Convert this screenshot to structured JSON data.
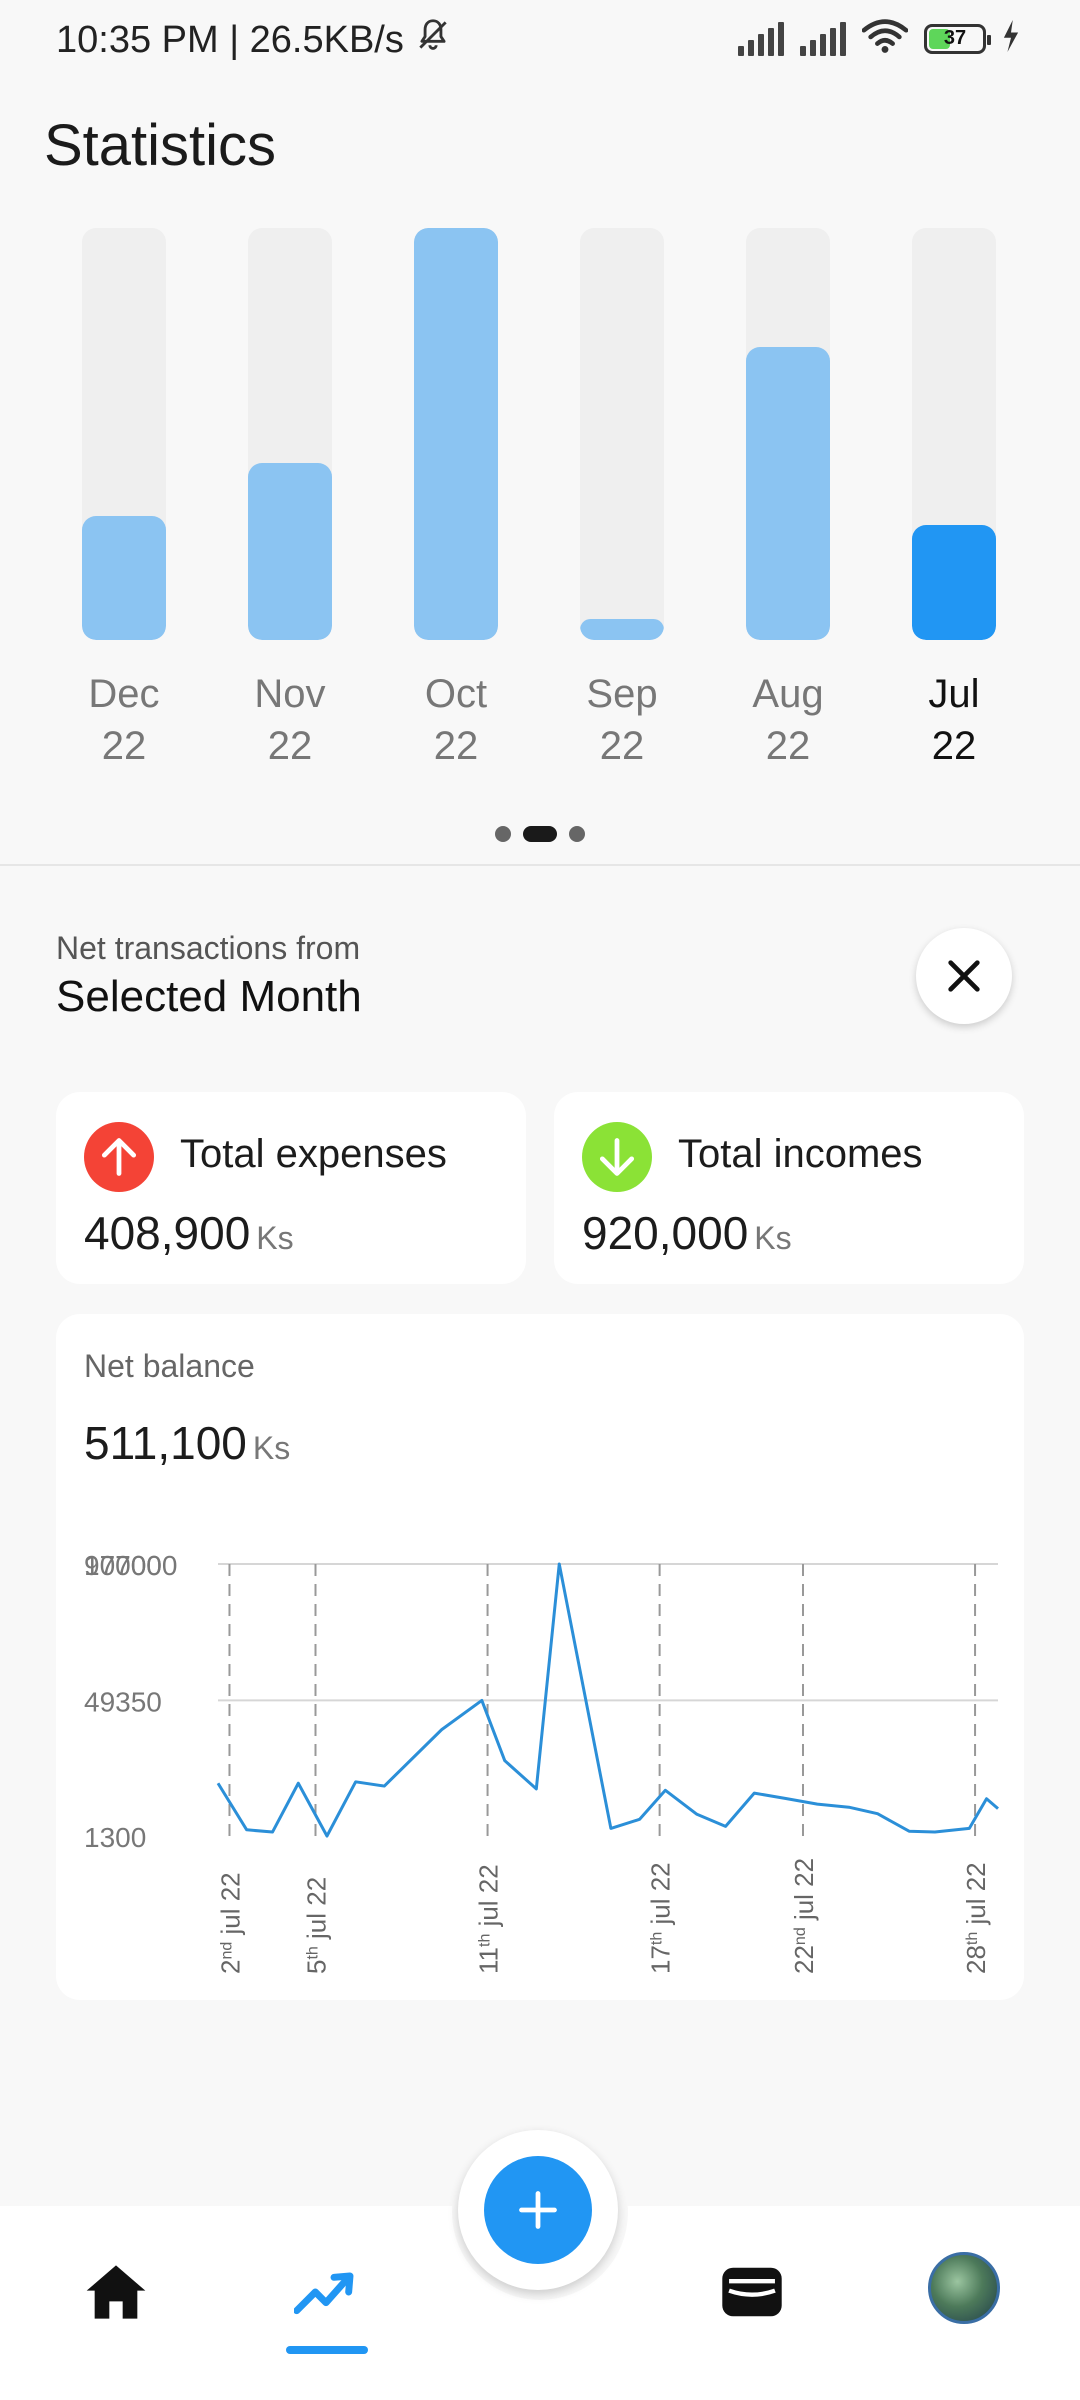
{
  "status_bar": {
    "time_speed": "10:35 PM | 26.5KB/s",
    "battery": "37"
  },
  "title": "Statistics",
  "bar_chart": [
    {
      "month": "Dec",
      "year": "22",
      "level": 0.3,
      "active": false
    },
    {
      "month": "Nov",
      "year": "22",
      "level": 0.43,
      "active": false
    },
    {
      "month": "Oct",
      "year": "22",
      "level": 1.0,
      "active": false
    },
    {
      "month": "Sep",
      "year": "22",
      "level": 0.05,
      "active": false
    },
    {
      "month": "Aug",
      "year": "22",
      "level": 0.71,
      "active": false
    },
    {
      "month": "Jul",
      "year": "22",
      "level": 0.28,
      "active": true
    }
  ],
  "pager": {
    "count": 3,
    "active": 1
  },
  "net": {
    "subtitle": "Net transactions from",
    "title": "Selected Month"
  },
  "expenses": {
    "label": "Total expenses",
    "amount": "408,900",
    "unit": "Ks",
    "color": "#f44336"
  },
  "incomes": {
    "label": "Total incomes",
    "amount": "920,000",
    "unit": "Ks",
    "color": "#8be236"
  },
  "balance": {
    "label": "Net balance",
    "amount": "511,100",
    "unit": "Ks"
  },
  "chart_data": {
    "type": "line",
    "y_tick_labels": [
      "100000",
      "97700",
      "49350",
      "1300"
    ],
    "y_ticks": [
      97700,
      49350,
      1300
    ],
    "ylim": [
      1300,
      97700
    ],
    "x_tick_labels": [
      {
        "day": "2",
        "suffix": "nd",
        "rest": " jul 22",
        "x": 2
      },
      {
        "day": "5",
        "suffix": "th",
        "rest": " jul 22",
        "x": 5
      },
      {
        "day": "11",
        "suffix": "th",
        "rest": " jul 22",
        "x": 11
      },
      {
        "day": "17",
        "suffix": "th",
        "rest": " jul 22",
        "x": 17
      },
      {
        "day": "22",
        "suffix": "nd",
        "rest": " jul 22",
        "x": 22
      },
      {
        "day": "28",
        "suffix": "th",
        "rest": " jul 22",
        "x": 28
      }
    ],
    "xlim": [
      1.6,
      28.8
    ],
    "x": [
      1.6,
      2.6,
      3.5,
      4.4,
      5.4,
      6.4,
      7.4,
      9.4,
      10.8,
      11.6,
      12.7,
      13.5,
      15.3,
      16.3,
      17.2,
      18.3,
      19.3,
      20.3,
      21.4,
      22.5,
      23.6,
      24.6,
      25.7,
      26.6,
      27.8,
      28.4,
      28.8
    ],
    "y": [
      20000,
      3500,
      2700,
      20000,
      1300,
      20500,
      19000,
      39000,
      49350,
      28000,
      18000,
      97700,
      4000,
      7200,
      17500,
      9000,
      4700,
      16500,
      14600,
      12600,
      11500,
      9200,
      3000,
      2700,
      4000,
      14500,
      11000
    ],
    "grid": true
  },
  "nav": {
    "items": [
      "home-icon",
      "chart-icon",
      "add-icon",
      "wallet-icon",
      "avatar"
    ],
    "active": "chart-icon",
    "accent": "#2196f3"
  }
}
